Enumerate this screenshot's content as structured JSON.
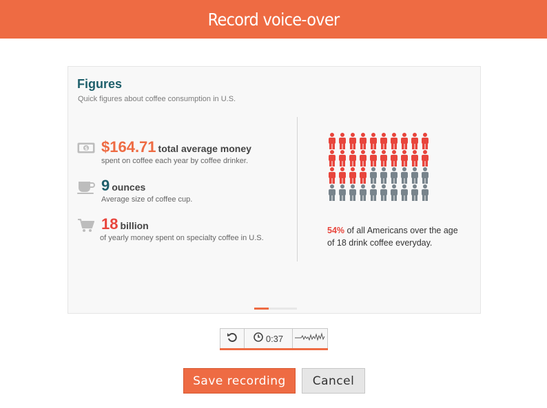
{
  "header": {
    "title": "Record voice-over"
  },
  "slide": {
    "title": "Figures",
    "subtitle": "Quick figures about coffee consumption in U.S.",
    "stats": [
      {
        "icon": "money-icon",
        "value": "$164.71",
        "value_color": "#ee6b43",
        "unit": "total average money",
        "description": "spent on coffee each year by coffee drinker."
      },
      {
        "icon": "coffee-cup-icon",
        "value": "9",
        "value_color": "#1e5f6b",
        "unit": "ounces",
        "description": "Average size of coffee cup."
      },
      {
        "icon": "shopping-cart-icon",
        "value": "18",
        "value_color": "#e8453c",
        "unit": "billion",
        "description": "of yearly money spent on specialty coffee in U.S."
      }
    ],
    "people_chart": {
      "rows": 4,
      "columns": 10,
      "highlighted": 24,
      "highlight_color": "#e8453c",
      "base_color": "#78848c"
    },
    "percent_stat": {
      "value": "54%",
      "text": "of all Americans over the age of 18 drink coffee everyday."
    },
    "progress": {
      "current": 1,
      "total": 3
    }
  },
  "player": {
    "time": "0:37"
  },
  "actions": {
    "save_label": "Save recording",
    "cancel_label": "Cancel"
  },
  "colors": {
    "accent": "#ee6b43",
    "teal": "#1e5f6b",
    "red": "#e8453c"
  }
}
